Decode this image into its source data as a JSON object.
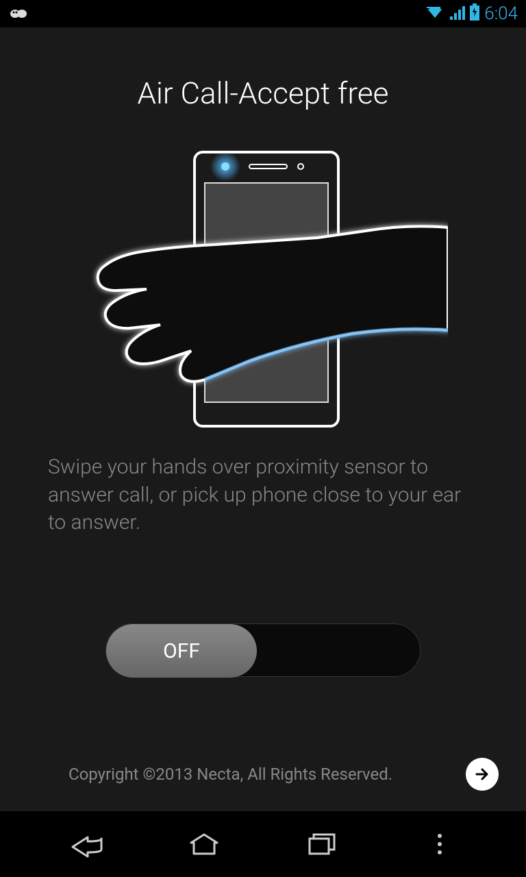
{
  "status_bar": {
    "time": "6:04"
  },
  "app": {
    "title": "Air Call-Accept free",
    "description": "Swipe your hands over proximity sensor to answer call, or pick up phone close to your ear to answer.",
    "toggle": {
      "state": "OFF"
    },
    "copyright": "Copyright ©2013 Necta, All Rights Reserved."
  }
}
